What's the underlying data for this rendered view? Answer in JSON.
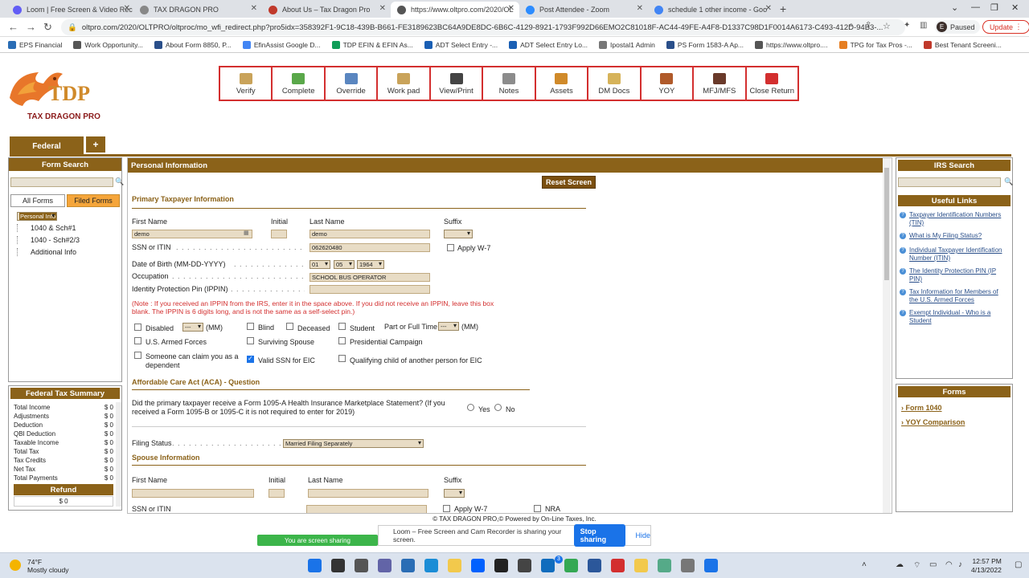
{
  "browser": {
    "tabs": [
      {
        "title": "Loom | Free Screen & Video Rec",
        "color": "#625df5"
      },
      {
        "title": "TAX DRAGON PRO",
        "color": "#888888"
      },
      {
        "title": "About Us – Tax Dragon Pro",
        "color": "#c0392b"
      },
      {
        "title": "https://www.oltpro.com/2020/OL",
        "color": "#555555"
      },
      {
        "title": "Post Attendee - Zoom",
        "color": "#2d8cff"
      },
      {
        "title": "schedule 1 other income - Goo",
        "color": "#4285f4"
      }
    ],
    "url": "oltpro.com/2020/OLTPRO/oltproc/mo_wfi_redirect.php?pro5idx=358392F1-9C18-439B-B661-FE3189623BC64A9DE8DC-6B6C-4129-8921-1793F992D66EMO2C81018F-AC44-49FE-A4F8-D1337C98D1F0014A6173-C493-412D-94B3-...",
    "profile_initial": "E",
    "profile_status": "Paused",
    "update_label": "Update",
    "bookmarks": [
      {
        "label": "EPS Financial",
        "color": "#2a6db5"
      },
      {
        "label": "Work Opportunity...",
        "color": "#555555"
      },
      {
        "label": "About Form 8850, P...",
        "color": "#2a4f8a"
      },
      {
        "label": "EfinAssist Google D...",
        "color": "#4285f4"
      },
      {
        "label": "TDP EFIN & EFIN As...",
        "color": "#0f9d58"
      },
      {
        "label": "ADT Select Entry -...",
        "color": "#1a5fb4"
      },
      {
        "label": "ADT Select Entry Lo...",
        "color": "#1a5fb4"
      },
      {
        "label": "Ipostal1 Admin",
        "color": "#777777"
      },
      {
        "label": "PS Form 1583-A Ap...",
        "color": "#2a4f8a"
      },
      {
        "label": "https://www.oltpro....",
        "color": "#555555"
      },
      {
        "label": "TPG for Tax Pros -...",
        "color": "#e67e22"
      },
      {
        "label": "Best Tenant Screeni...",
        "color": "#c0392b"
      }
    ]
  },
  "app": {
    "logo_text": "TDP",
    "logo_subtext": "TAX DRAGON PRO",
    "toolbar": [
      {
        "label": "Verify",
        "icon": "clipboard-icon",
        "color": "#c9a35a"
      },
      {
        "label": "Complete",
        "icon": "check-icon",
        "color": "#5aa84a"
      },
      {
        "label": "Override",
        "icon": "form-icon",
        "color": "#5a86c0"
      },
      {
        "label": "Work pad",
        "icon": "notepad-icon",
        "color": "#c9a35a"
      },
      {
        "label": "View/Print",
        "icon": "printer-icon",
        "color": "#444444"
      },
      {
        "label": "Notes",
        "icon": "notes-icon",
        "color": "#8c8c8c"
      },
      {
        "label": "Assets",
        "icon": "bar-chart-icon",
        "color": "#d08a2a"
      },
      {
        "label": "DM Docs",
        "icon": "folder-icon",
        "color": "#d6b35a"
      },
      {
        "label": "YOY",
        "icon": "compare-icon",
        "color": "#b05a2a"
      },
      {
        "label": "MFJ/MFS",
        "icon": "people-icon",
        "color": "#6a3a2a"
      },
      {
        "label": "Close Return",
        "icon": "close-icon",
        "color": "#d32f2f"
      }
    ],
    "federal_tab": "Federal",
    "plus_tab": "+"
  },
  "left": {
    "form_search_title": "Form Search",
    "all_forms": "All Forms",
    "filed_forms": "Filed Forms",
    "tree": [
      "Personal Info",
      "1040 & Sch#1",
      "1040 - Sch#2/3",
      "Additional Info"
    ],
    "summary_title": "Federal Tax Summary",
    "summary": [
      {
        "label": "Total Income",
        "value": "$ 0"
      },
      {
        "label": "Adjustments",
        "value": "$ 0"
      },
      {
        "label": "Deduction",
        "value": "$ 0"
      },
      {
        "label": "QBI Deduction",
        "value": "$ 0"
      },
      {
        "label": "Taxable Income",
        "value": "$ 0"
      },
      {
        "label": "Total Tax",
        "value": "$ 0"
      },
      {
        "label": "Tax Credits",
        "value": "$ 0"
      },
      {
        "label": "Net Tax",
        "value": "$ 0"
      },
      {
        "label": "Total Payments",
        "value": "$ 0"
      }
    ],
    "refund_label": "Refund",
    "refund_value": "$ 0"
  },
  "main": {
    "header": "Personal Information",
    "reset": "Reset Screen",
    "primary_title": "Primary Taxpayer Information",
    "first_name_label": "First Name",
    "initial_label": "Initial",
    "last_name_label": "Last Name",
    "suffix_label": "Suffix",
    "first_name": "demo",
    "last_name": "demo",
    "ssn_label": "SSN or ITIN",
    "ssn": "062620480",
    "apply_w7": "Apply W-7",
    "dob_label": "Date of Birth (MM-DD-YYYY)",
    "dob_month": "01",
    "dob_day": "05",
    "dob_year": "1964",
    "occupation_label": "Occupation",
    "occupation": "SCHOOL BUS OPERATOR",
    "ippin_label": "Identity Protection Pin (IPPIN)",
    "note": "(Note : If you received an IPPIN from the IRS, enter it in the space above. If you did not receive an IPPIN, leave this box blank. The IPPIN is 6 digits long, and is not the same as a self-select pin.)",
    "disabled": "Disabled",
    "disabled_sel": "---",
    "mm": "(MM)",
    "blind": "Blind",
    "deceased": "Deceased",
    "student": "Student",
    "part_full": "Part or Full Time",
    "part_sel": "---",
    "armed": "U.S. Armed Forces",
    "surviving": "Surviving Spouse",
    "presidential": "Presidential Campaign",
    "someone_claim": "Someone can claim you as a dependent",
    "valid_ssn": "Valid SSN for EIC",
    "qualifying": "Qualifying child of another person for EIC",
    "aca_title": "Affordable Care Act (ACA) - Question",
    "aca_question": "Did the primary taxpayer receive a Form 1095-A Health Insurance Marketplace Statement? (If you received a Form 1095-B or 1095-C it is not required to enter for 2019)",
    "yes": "Yes",
    "no": "No",
    "filing_label": "Filing Status",
    "filing_value": "Married Filing Separately",
    "spouse_title": "Spouse Information",
    "sp_first": "First Name",
    "sp_initial": "Initial",
    "sp_last": "Last Name",
    "sp_suffix": "Suffix",
    "sp_ssn": "SSN or ITIN",
    "sp_w7": "Apply W-7",
    "sp_nra": "NRA"
  },
  "right": {
    "irs_title": "IRS Search",
    "useful_title": "Useful Links",
    "links": [
      "Taxpayer Identification Numbers (TIN)",
      "What is My Filing Status?",
      "Individual Taxpayer Identification Number (ITIN)",
      "The Identity Protection PIN (IP PIN)",
      "Tax Information for Members of the U.S. Armed Forces",
      "Exempt Individual - Who is a Student"
    ],
    "forms_title": "Forms",
    "forms": [
      "Form 1040",
      "YOY Comparison"
    ]
  },
  "footer": "© TAX DRAGON PRO,© Powered by On-Line Taxes, Inc.",
  "share": {
    "sharing": "You are screen sharing",
    "loom_msg": "Loom – Free Screen and Cam Recorder is sharing your screen.",
    "stop": "Stop sharing",
    "hide": "Hide"
  },
  "taskbar": {
    "temp": "74°F",
    "condition": "Mostly cloudy",
    "time": "12:57 PM",
    "date": "4/13/2022",
    "badge": "3"
  }
}
